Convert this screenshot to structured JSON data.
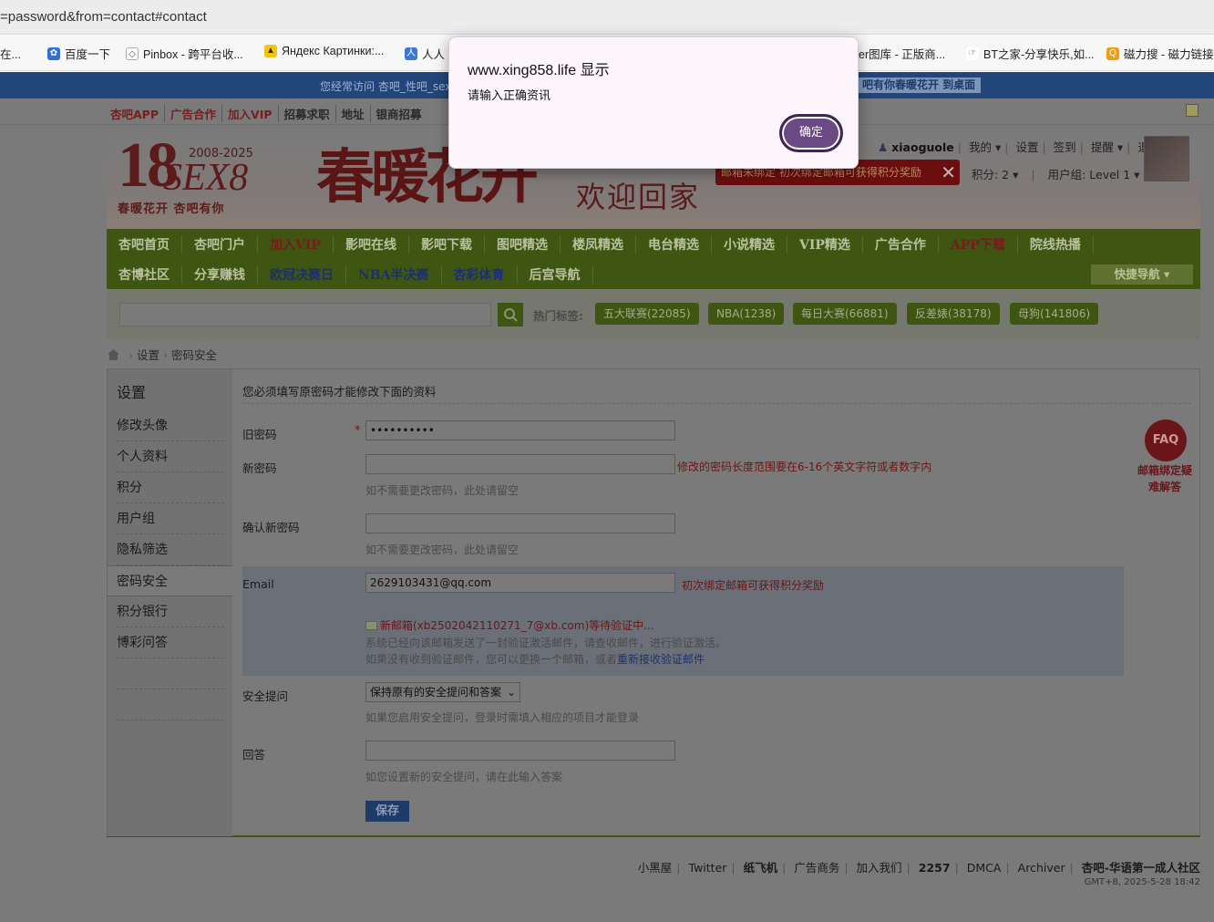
{
  "browser": {
    "url": "=password&from=contact#contact",
    "bookmarks": [
      "在...",
      "百度一下",
      "Pinbox - 跨平台收...",
      "Яндекс Картинки:...",
      "人人",
      "er图库 - 正版商...",
      "BT之家-分享快乐,如...",
      "磁力搜 - 磁力链接"
    ]
  },
  "notice": {
    "text": "您经常访问 杏吧_性吧_sex",
    "button": "吧有你春暖花开 到桌面"
  },
  "topnav": [
    "杏吧APP",
    "广告合作",
    "加入VIP",
    "招募求职",
    "地址",
    "银商招募"
  ],
  "header": {
    "logo_num": "18",
    "logo_sex": "SEX8",
    "logo_years": "2008-2025",
    "logo_slogan": "春暖花开 杏吧有你",
    "big_title": "春暖花开",
    "welcome": "欢迎回家",
    "email_warn": "邮箱未绑定 初次绑定邮箱可获得积分奖励",
    "username": "xiaoguole",
    "user_links": [
      "我的",
      "设置",
      "签到",
      "提醒",
      "退出"
    ],
    "points": "积分: 2",
    "usergroup": "用户组: Level 1"
  },
  "mainnav": {
    "row1": [
      "杏吧首页",
      "杏吧门户",
      "加入VIP",
      "影吧在线",
      "影吧下载",
      "图吧精选",
      "楼凤精选",
      "电台精选",
      "小说精选",
      "VIP精选",
      "广告合作",
      "APP下载",
      "院线热播"
    ],
    "row2": [
      "杏博社区",
      "分享赚钱",
      "欧冠决赛日",
      "NBA半决赛",
      "杏彩体育",
      "后宫导航"
    ],
    "quick": "快捷导航"
  },
  "search": {
    "hot_label": "热门标签:",
    "tags": [
      "五大联赛(22085)",
      "NBA(1238)",
      "每日大赛(66881)",
      "反差婊(38178)",
      "母狗(141806)"
    ]
  },
  "breadcrumb": [
    "设置",
    "密码安全"
  ],
  "sidebar": {
    "title": "设置",
    "items": [
      "修改头像",
      "个人资料",
      "积分",
      "用户组",
      "隐私筛选",
      "密码安全",
      "积分银行",
      "博彩问答"
    ]
  },
  "form": {
    "note": "您必须填写原密码才能修改下面的资料",
    "old_pw_label": "旧密码",
    "old_pw_value": "••••••••••",
    "new_pw_label": "新密码",
    "new_pw_err": "修改的密码长度范围要在6-16个英文字符或者数字内",
    "new_pw_hint": "如不需要更改密码，此处请留空",
    "confirm_label": "确认新密码",
    "confirm_hint": "如不需要更改密码，此处请留空",
    "email_label": "Email",
    "email_value": "2629103431@qq.com",
    "email_err": "初次绑定邮箱可获得积分奖励",
    "email_pending": "新邮箱(xb2502042110271_7@xb.com)等待验证中...",
    "email_sent": "系统已经向该邮箱发送了一封验证激活邮件，请查收邮件，进行验证激活。",
    "email_resend_prefix": "如果没有收到验证邮件，您可以更换一个邮箱，或者",
    "email_resend_link": "重新接收验证邮件",
    "question_label": "安全提问",
    "question_value": "保持原有的安全提问和答案",
    "question_hint": "如果您启用安全提问，登录时需填入相应的项目才能登录",
    "answer_label": "回答",
    "answer_hint": "如您设置新的安全提问，请在此输入答案",
    "save": "保存",
    "faq": "FAQ",
    "faq_text": "邮箱绑定疑难解答"
  },
  "footer": {
    "links": [
      "小黑屋",
      "Twitter",
      "纸飞机",
      "广告商务",
      "加入我们",
      "2257",
      "DMCA",
      "Archiver",
      "杏吧-华语第一成人社区"
    ],
    "time": "GMT+8, 2025-5-28 18:42"
  },
  "dialog": {
    "title": "www.xing858.life 显示",
    "message": "请输入正确资讯",
    "ok": "确定"
  }
}
